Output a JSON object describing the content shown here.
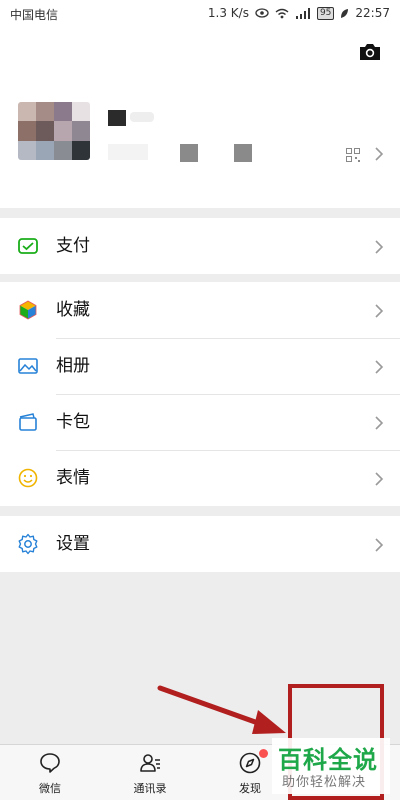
{
  "status_bar": {
    "carrier": "中国电信",
    "network_speed": "1.3 K/s",
    "battery": "95",
    "time": "22:57"
  },
  "profile": {
    "camera_icon": "camera-icon",
    "qr_icon": "qr-code-icon"
  },
  "menu": {
    "pay": {
      "label": "支付",
      "icon": "wallet-check-icon",
      "color": "#1aad19"
    },
    "favorites": {
      "label": "收藏",
      "icon": "cube-icon"
    },
    "album": {
      "label": "相册",
      "icon": "image-icon",
      "color": "#2782d7"
    },
    "cards": {
      "label": "卡包",
      "icon": "card-icon",
      "color": "#2782d7"
    },
    "stickers": {
      "label": "表情",
      "icon": "smiley-icon",
      "color": "#f0b400"
    },
    "settings": {
      "label": "设置",
      "icon": "gear-icon",
      "color": "#2782d7"
    }
  },
  "tabbar": {
    "tabs": [
      {
        "label": "微信",
        "icon": "chat-bubble-icon"
      },
      {
        "label": "通讯录",
        "icon": "contacts-icon"
      },
      {
        "label": "发现",
        "icon": "compass-icon"
      }
    ]
  },
  "watermark": {
    "title": "百科全说",
    "subtitle": "助你轻松解决"
  }
}
